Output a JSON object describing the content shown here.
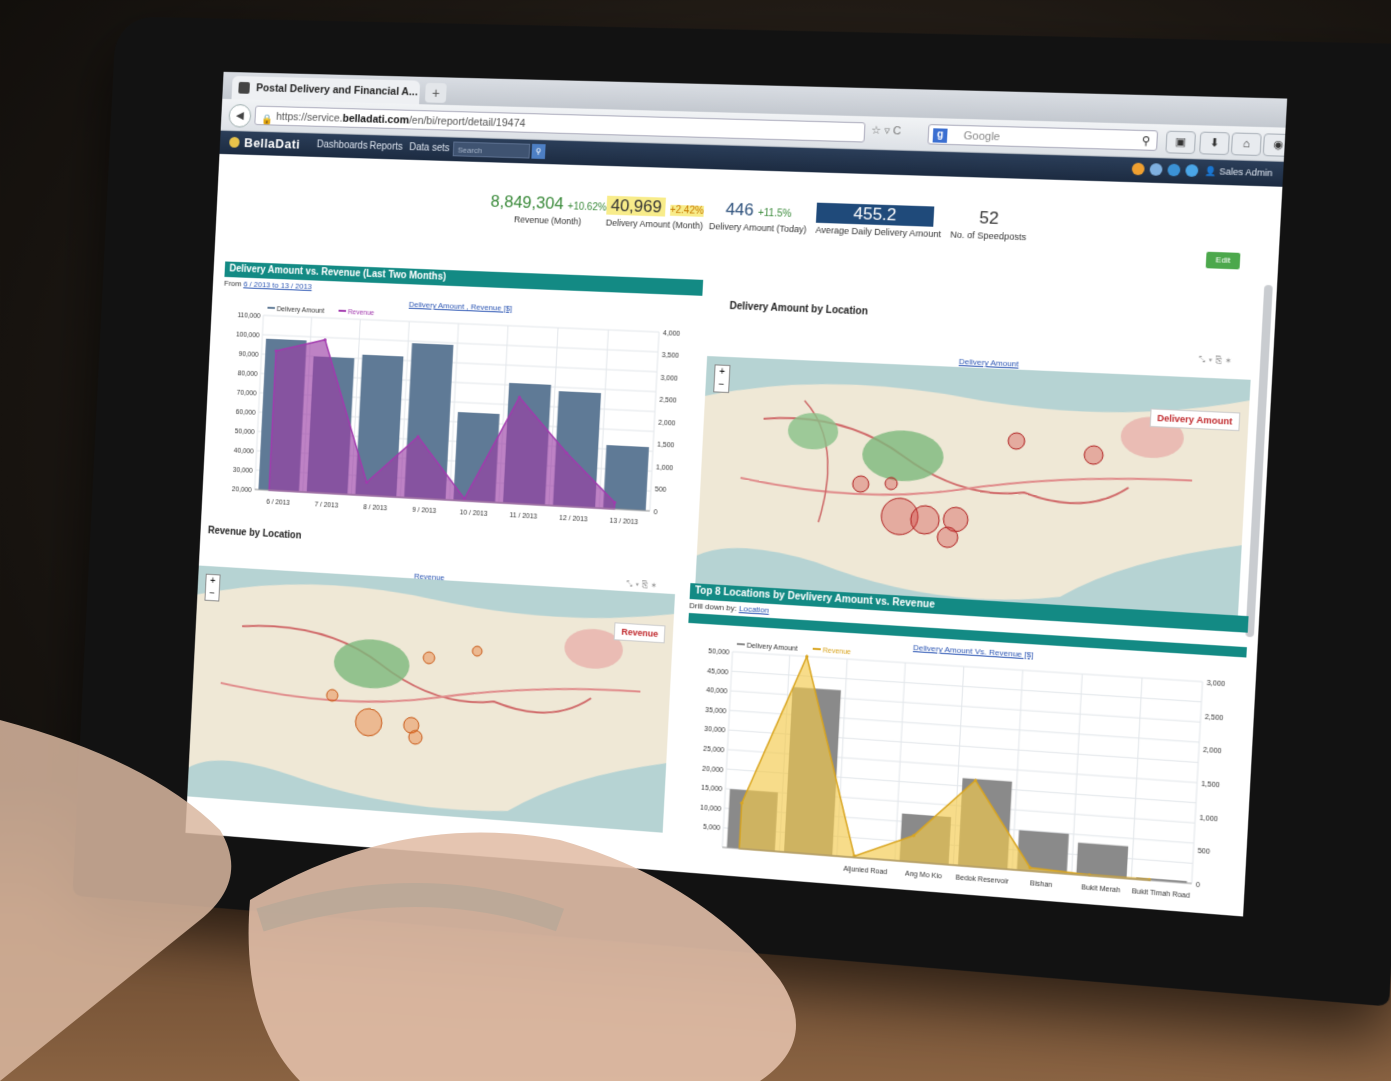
{
  "browser": {
    "tab_title": "Postal Delivery and Financial A...",
    "new_tab": "+",
    "url_prefix": "https://service.",
    "url_domain": "belladati.com",
    "url_path": "/en/bi/report/detail/19474",
    "search_placeholder": "Google"
  },
  "app": {
    "logo": "BellaDati",
    "menu": [
      "Dashboards",
      "Reports",
      "Data sets"
    ],
    "search_placeholder": "Search",
    "user": "Sales Admin",
    "edit_label": "Edit"
  },
  "kpis": [
    {
      "value": "8,849,304",
      "delta": "+10.62%",
      "label": "Revenue (Month)"
    },
    {
      "value": "40,969",
      "delta": "+2.42%",
      "label": "Delivery Amount (Month)"
    },
    {
      "value": "446",
      "delta": "+11.5%",
      "label": "Delivery Amount (Today)"
    },
    {
      "value": "455.2",
      "delta": "",
      "label": "Average Daily Delivery Amount"
    },
    {
      "value": "52",
      "delta": "",
      "label": "No. of Speedposts"
    }
  ],
  "panel1": {
    "title": "Delivery Amount vs. Revenue (Last Two Months)",
    "from_label": "From",
    "range": "6 / 2013 to 13 / 2013",
    "links": "Delivery Amount , Revenue [$]"
  },
  "panel2": {
    "title": "Delivery Amount by Location",
    "link": "Delivery Amount",
    "legend": "Delivery Amount"
  },
  "panel3": {
    "title": "Revenue by Location",
    "link": "Revenue",
    "legend": "Revenue"
  },
  "panel4": {
    "title": "Top 8 Locations by Devlivery Amount vs. Revenue",
    "drill_label": "Drill down by:",
    "drill_link": "Location",
    "links": "Delivery Amount Vs. Revenue [$]"
  },
  "colors": {
    "teal_header": "#138a84",
    "bar_blue": "#5f7a96",
    "purple_area": "#9b3fa6",
    "bar_gray": "#8a8a8a",
    "yellow_area": "#f2c94c",
    "map_circle": "#d23a3a",
    "map_circle_orange": "#e8722a"
  },
  "chart_data": [
    {
      "type": "bar",
      "categories": [
        "6 / 2013",
        "7 / 2013",
        "8 / 2013",
        "9 / 2013",
        "10 / 2013",
        "11 / 2013",
        "12 / 2013",
        "13 / 2013"
      ],
      "series": [
        {
          "name": "Delivery Amount",
          "type": "bar",
          "axis": "left",
          "values": [
            98000,
            90000,
            92000,
            99000,
            65000,
            81000,
            78000,
            52000
          ]
        },
        {
          "name": "Revenue",
          "type": "area",
          "axis": "right",
          "values": [
            3200,
            3500,
            300,
            1400,
            50,
            2400,
            1200,
            150
          ]
        }
      ],
      "yticks_left": [
        "20,000",
        "30,000",
        "40,000",
        "50,000",
        "60,000",
        "70,000",
        "80,000",
        "90,000",
        "100,000",
        "110,000"
      ],
      "yticks_right": [
        "0",
        "500",
        "1,000",
        "1,500",
        "2,000",
        "2,500",
        "3,000",
        "3,500",
        "4,000"
      ],
      "ylim_left": [
        20000,
        110000
      ],
      "ylim_right": [
        0,
        4000
      ],
      "grid": true,
      "legend": "top-left"
    },
    {
      "type": "bar",
      "categories": [
        "",
        "",
        "Aljunied Road",
        "Ang Mo Kio",
        "Bedok Reservoir",
        "Bishan",
        "Bukit Merah",
        "Bukit Timah Road"
      ],
      "series": [
        {
          "name": "Delivery Amount",
          "type": "bar",
          "axis": "left",
          "values": [
            15000,
            42000,
            0,
            12000,
            22000,
            10000,
            8000,
            500
          ]
        },
        {
          "name": "Revenue",
          "type": "area",
          "axis": "right",
          "values": [
            700,
            3000,
            20,
            400,
            1300,
            50,
            10,
            10
          ]
        }
      ],
      "yticks_left": [
        "5,000",
        "10,000",
        "15,000",
        "20,000",
        "25,000",
        "30,000",
        "35,000",
        "40,000",
        "45,000",
        "50,000"
      ],
      "yticks_right": [
        "0",
        "500",
        "1,000",
        "1,500",
        "2,000",
        "2,500",
        "3,000"
      ],
      "ylim_left": [
        0,
        50000
      ],
      "ylim_right": [
        0,
        3000
      ],
      "grid": true,
      "legend": "top-left"
    }
  ]
}
